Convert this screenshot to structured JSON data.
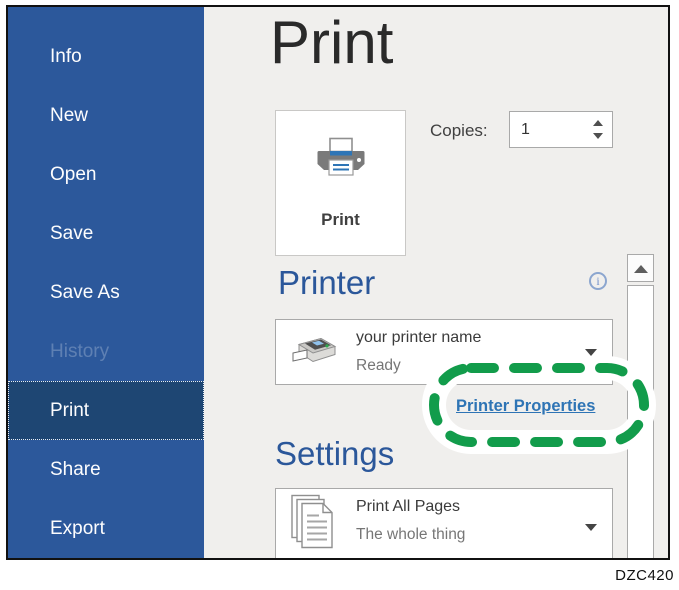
{
  "sidebar": {
    "items": [
      {
        "label": "Info",
        "state": "normal"
      },
      {
        "label": "New",
        "state": "normal"
      },
      {
        "label": "Open",
        "state": "normal"
      },
      {
        "label": "Save",
        "state": "normal"
      },
      {
        "label": "Save As",
        "state": "normal"
      },
      {
        "label": "History",
        "state": "disabled"
      },
      {
        "label": "Print",
        "state": "selected"
      },
      {
        "label": "Share",
        "state": "normal"
      },
      {
        "label": "Export",
        "state": "normal"
      }
    ]
  },
  "main": {
    "title": "Print",
    "print_button": {
      "label": "Print",
      "icon": "printer-icon"
    },
    "copies": {
      "label": "Copies:",
      "value": "1"
    },
    "printer": {
      "heading": "Printer",
      "name": "your printer name",
      "status": "Ready",
      "properties_link": "Printer Properties",
      "icon": "printer-device-icon",
      "info_icon": "info-icon"
    },
    "settings": {
      "heading": "Settings",
      "option": "Print All Pages",
      "description": "The whole thing",
      "icon": "document-pages-icon"
    }
  },
  "annotation": {
    "shape": "green-dashed-ellipse",
    "highlights": "Printer Properties"
  },
  "figure_label": "DZC420",
  "icons": {
    "info_glyph": "i"
  },
  "colors": {
    "sidebar_blue": "#2C589B",
    "selected_item_blue": "#1E4673",
    "heading_blue": "#2B579A",
    "link_blue": "#2E74B5",
    "annotation_green": "#129C4B",
    "main_background": "#F0EFED",
    "control_border_gray": "#A9A9A9",
    "printer_accent_blue": "#2E75B6"
  }
}
